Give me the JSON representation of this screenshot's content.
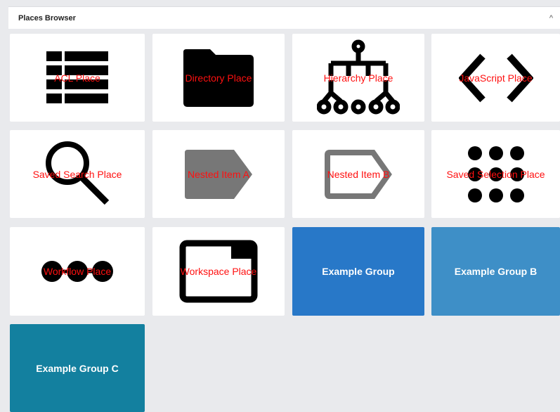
{
  "panel": {
    "title": "Places Browser",
    "collapse_icon": "chevron-up-icon",
    "collapse_glyph": "^"
  },
  "tiles": [
    {
      "label": "ACL Place",
      "icon": "acl-list-icon"
    },
    {
      "label": "Directory Place",
      "icon": "folder-icon"
    },
    {
      "label": "Hierarchy Place",
      "icon": "hierarchy-tree-icon"
    },
    {
      "label": "JavaScript Place",
      "icon": "code-brackets-icon"
    },
    {
      "label": "Saved Search Place",
      "icon": "magnifier-icon"
    },
    {
      "label": "Nested Item A",
      "icon": "tag-filled-icon"
    },
    {
      "label": "Nested Item B",
      "icon": "tag-outline-icon"
    },
    {
      "label": "Saved Selection Place",
      "icon": "dot-grid-icon"
    },
    {
      "label": "Workflow Place",
      "icon": "workflow-dots-icon"
    },
    {
      "label": "Workspace Place",
      "icon": "workspace-window-icon"
    },
    {
      "label": "Example Group",
      "color": "#2878c8"
    },
    {
      "label": "Example Group B",
      "color": "#3e8fc7"
    },
    {
      "label": "Example Group C",
      "color": "#13809f"
    }
  ]
}
